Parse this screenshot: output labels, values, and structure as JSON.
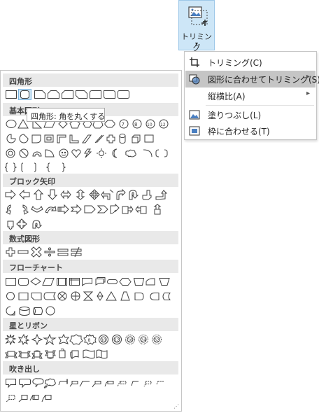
{
  "ribbon": {
    "trim_label": "トリミング",
    "dropdown_arrow": "▾"
  },
  "menu": {
    "items": [
      {
        "label": "トリミング(C)",
        "icon": "crop-icon"
      },
      {
        "label": "図形に合わせてトリミング(S)",
        "icon": "crop-to-shape-icon",
        "has_submenu": true
      },
      {
        "label": "縦横比(A)",
        "has_submenu": true
      },
      {
        "label": "塗りつぶし(L)",
        "icon": "fill-icon"
      },
      {
        "label": "枠に合わせる(T)",
        "icon": "fit-icon"
      }
    ],
    "submenu_arrow": "▸"
  },
  "gallery": {
    "sections": [
      {
        "label": "四角形"
      },
      {
        "label": "基本図形"
      },
      {
        "label": "ブロック矢印"
      },
      {
        "label": "数式図形"
      },
      {
        "label": "フローチャート"
      },
      {
        "label": "星とリボン"
      },
      {
        "label": "吹き出し"
      }
    ],
    "grip": "⋰"
  },
  "tooltip": {
    "text": "四角形: 角を丸くする"
  },
  "colors": {
    "hover": "#cde6f7",
    "header_bg": "#e9e9e9",
    "stroke": "#404040",
    "menu_highlight": "#c5c5c5"
  }
}
